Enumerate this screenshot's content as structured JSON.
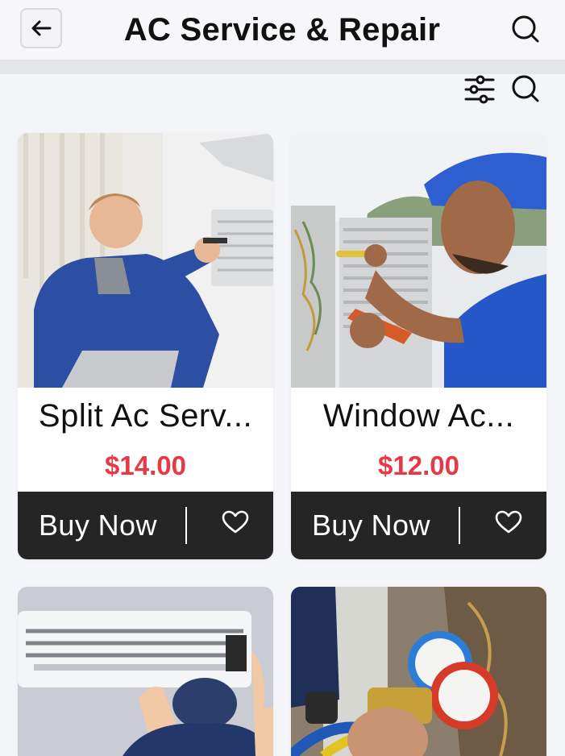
{
  "header": {
    "title": "AC Service & Repair",
    "back_icon": "arrow-left-icon",
    "search_icon": "search-icon"
  },
  "toolbar": {
    "filter_icon": "filter-sliders-icon",
    "search_icon": "search-icon"
  },
  "products": [
    {
      "name": "Split Ac Serv...",
      "price": "$14.00",
      "buy_label": "Buy Now",
      "favorite_icon": "heart-icon"
    },
    {
      "name": "Window Ac...",
      "price": "$12.00",
      "buy_label": "Buy Now",
      "favorite_icon": "heart-icon"
    },
    {
      "name": "",
      "price": "",
      "buy_label": "",
      "favorite_icon": "heart-icon"
    },
    {
      "name": "",
      "price": "",
      "buy_label": "",
      "favorite_icon": "heart-icon"
    }
  ],
  "colors": {
    "price": "#e63946",
    "action_bar": "#252525",
    "background": "#f4f5f8",
    "card": "#ffffff"
  }
}
